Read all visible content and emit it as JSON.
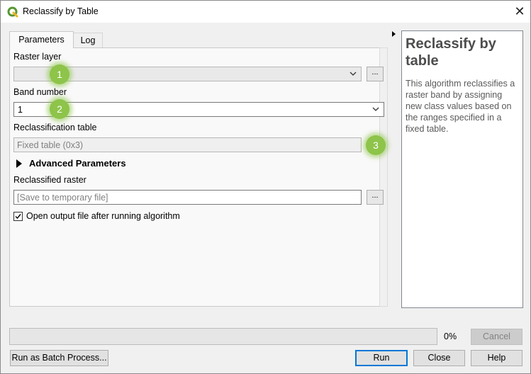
{
  "window": {
    "title": "Reclassify by Table",
    "close_glyph": "✕",
    "icon": "qgis-logo-icon",
    "accent_color": "#589632"
  },
  "tabs": [
    {
      "label": "Parameters",
      "active": true
    },
    {
      "label": "Log",
      "active": false
    }
  ],
  "params": {
    "raster_layer_label": "Raster layer",
    "raster_layer_value": "",
    "band_number_label": "Band number",
    "band_number_value": "1",
    "reclass_table_label": "Reclassification table",
    "reclass_table_value": "Fixed table (0x3)",
    "advanced_label": "Advanced Parameters",
    "reclassified_raster_label": "Reclassified raster",
    "reclassified_raster_placeholder": "[Save to temporary file]",
    "open_output_label": "Open output file after running algorithm",
    "open_output_checked": true,
    "browse_glyph": "...",
    "browse_menu_glyph": "..."
  },
  "callouts": [
    "1",
    "2",
    "3"
  ],
  "callout_color": "#8dc449",
  "help": {
    "title": "Reclassify by table",
    "body": "This algorithm reclassifies a raster band by assigning new class values based on the ranges specified in a fixed table."
  },
  "footer": {
    "progress_percent": 0,
    "progress_label": "0%",
    "cancel_label": "Cancel",
    "batch_label": "Run as Batch Process...",
    "run_label": "Run",
    "close_label": "Close",
    "help_label": "Help"
  }
}
